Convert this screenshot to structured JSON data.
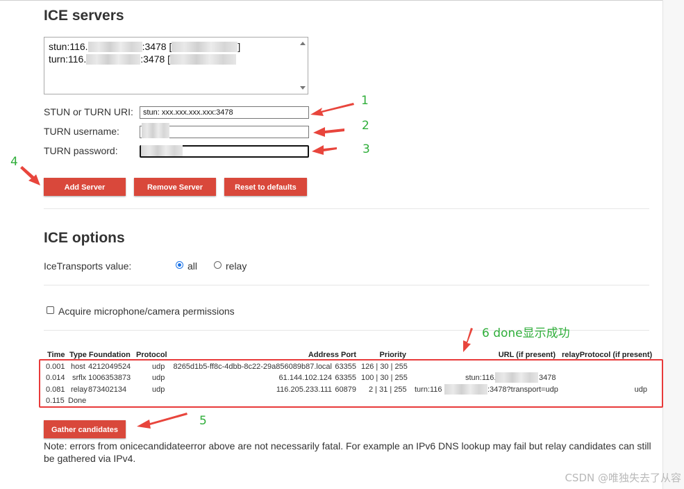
{
  "ice_servers": {
    "heading": "ICE servers",
    "list": [
      {
        "prefix": "stun:116.",
        "port": ":3478",
        "bracket": " ["
      },
      {
        "prefix": "turn:116.",
        "port": ":3478",
        "bracket": " ["
      }
    ],
    "list_first_close": "]",
    "uri_label": "STUN or TURN URI:",
    "uri_value": "stun: xxx.xxx.xxx.xxx:3478",
    "username_label": "TURN username:",
    "username_value": "",
    "password_label": "TURN password:",
    "password_value": "",
    "buttons": {
      "add": "Add Server",
      "remove": "Remove Server",
      "reset": "Reset to defaults"
    }
  },
  "ice_options": {
    "heading": "ICE options",
    "transports_label": "IceTransports value:",
    "radio_all": "all",
    "radio_relay": "relay",
    "selected": "all",
    "acquire_label": "Acquire microphone/camera permissions"
  },
  "candidates": {
    "headers": {
      "time": "Time",
      "type_foundation": "Type Foundation",
      "protocol": "Protocol",
      "address_port": "Address Port",
      "priority": "Priority",
      "url": "URL (if present)",
      "relay_protocol": "relayProtocol (if present)"
    },
    "rows": [
      {
        "time": "0.001",
        "type": "host",
        "foundation": "4212049524",
        "protocol": "udp",
        "address": "8265d1b5-ff8c-4dbb-8c22-29a856089b87.local",
        "port": "63355",
        "priority": "126 | 30 | 255",
        "url_prefix": "",
        "url_suffix": "",
        "relay_protocol": ""
      },
      {
        "time": "0.014",
        "type": "srflx",
        "foundation": "1006353873",
        "protocol": "udp",
        "address": "61.144.102.124",
        "port": "63355",
        "priority": "100 | 30 | 255",
        "url_prefix": "stun:116.",
        "url_suffix": "3478",
        "relay_protocol": ""
      },
      {
        "time": "0.081",
        "type": "relay",
        "foundation": "873402134",
        "protocol": "udp",
        "address": "116.205.233.111",
        "port": "60879",
        "priority": "2 | 31 | 255",
        "url_prefix": "turn:116",
        "url_suffix": ":3478?transport=udp",
        "relay_protocol": "udp"
      }
    ],
    "done_time": "0.115",
    "done_label": "Done",
    "gather_button": "Gather candidates",
    "note": "Note: errors from onicecandidateerror above are not necessarily fatal. For example an IPv6 DNS lookup may fail but relay candidates can still be gathered via IPv4."
  },
  "annotations": {
    "n1": "1",
    "n2": "2",
    "n3": "3",
    "n4": "4",
    "n5": "5",
    "n6": "6 done显示成功",
    "arrow_color": "#e8453c",
    "number_color": "#2fae3a"
  },
  "watermark": "CSDN @唯独失去了从容",
  "colors": {
    "button_red": "#d9483b",
    "radio_blue": "#1a73e8",
    "highlight_red": "#e83a3a"
  }
}
